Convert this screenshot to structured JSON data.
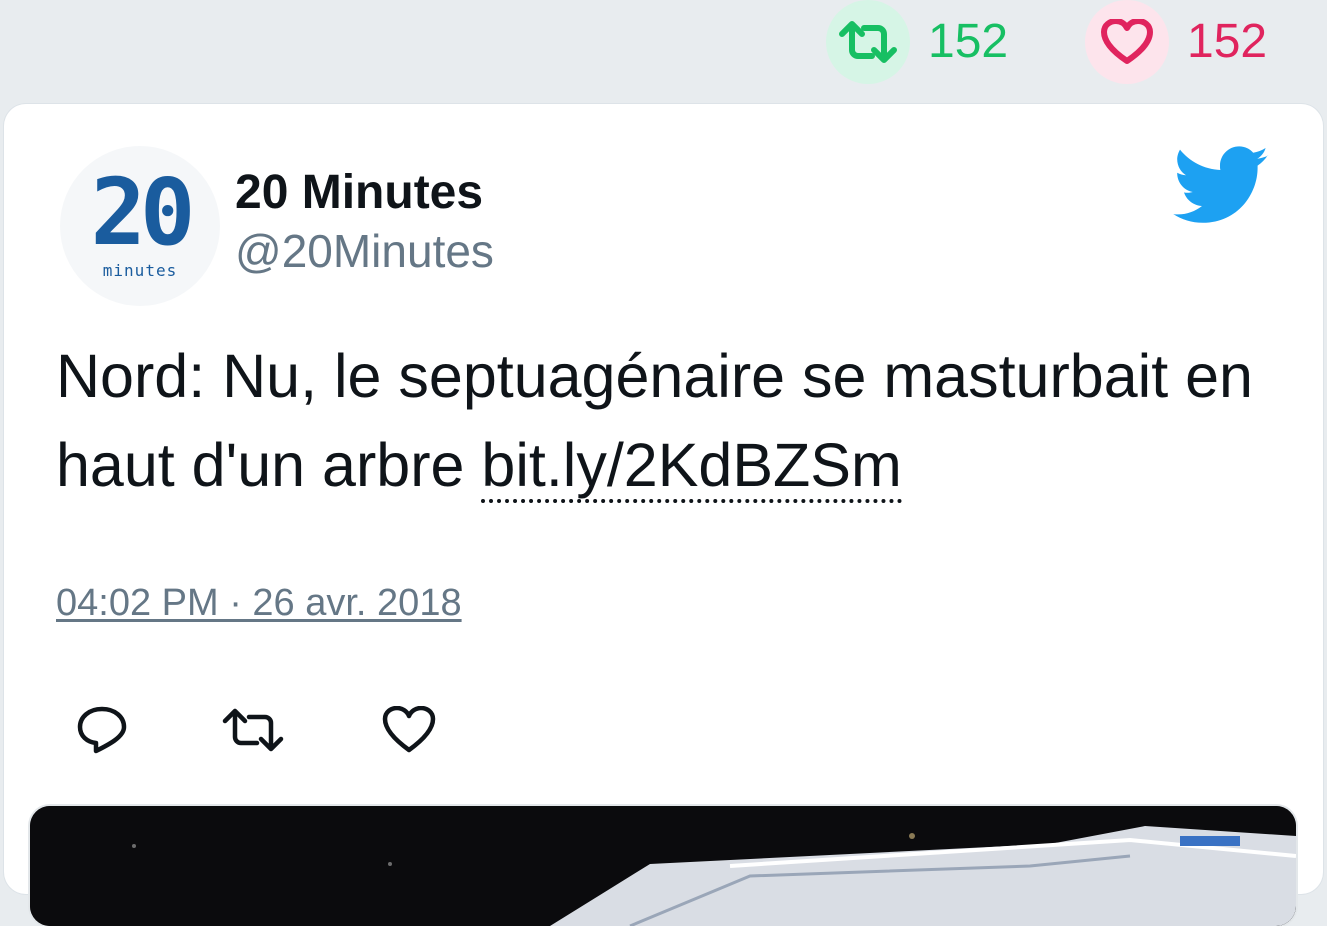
{
  "top_stats": {
    "retweet_count": "152",
    "like_count": "152",
    "retweet_icon": "retweet-icon",
    "like_icon": "heart-icon"
  },
  "tweet": {
    "author_name": "20 Minutes",
    "author_handle": "@20Minutes",
    "avatar_logo_number": "20",
    "avatar_logo_word": "minutes",
    "text_before_link": "Nord: Nu, le septuagénaire se masturbait en haut d'un arbre ",
    "link_text": "bit.ly/2KdBZSm",
    "timestamp": "04:02 PM · 26 avr. 2018",
    "actions": [
      "reply-icon",
      "retweet-icon",
      "heart-icon"
    ]
  },
  "colors": {
    "retweet_green": "#17bf63",
    "like_red": "#e0245e",
    "twitter_blue": "#1da1f2",
    "muted": "#657786",
    "background": "#e8ecef"
  }
}
